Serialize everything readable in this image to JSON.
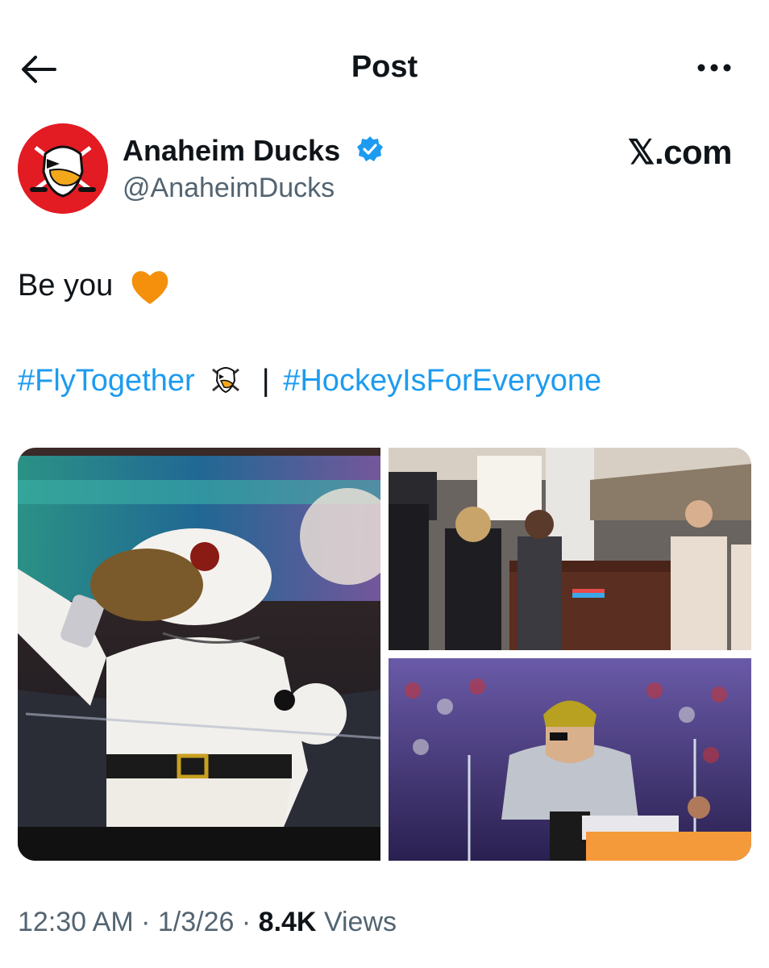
{
  "header": {
    "title": "Post",
    "back_icon": "arrow-left-icon",
    "more_icon": "more-horizontal-icon"
  },
  "author": {
    "name": "Anaheim Ducks",
    "handle": "@AnaheimDucks",
    "verified": true,
    "avatar_color": "#e31b23"
  },
  "source_label": "𝕏.com",
  "post": {
    "text": "Be you",
    "emoji": "orange-heart",
    "hashtag_1": "#FlyTogether",
    "separator": "|",
    "hashtag_2": "#HockeyIsForEveryone"
  },
  "media": [
    {
      "name": "mascot-photo"
    },
    {
      "name": "fan-table-photo"
    },
    {
      "name": "performer-photo"
    }
  ],
  "meta": {
    "time": "12:30 AM",
    "dot": "·",
    "date": "1/3/26",
    "views_count": "8.4K",
    "views_label": "Views"
  },
  "colors": {
    "link": "#1d9bf0",
    "secondary_text": "#536471",
    "primary_text": "#0f1419"
  }
}
